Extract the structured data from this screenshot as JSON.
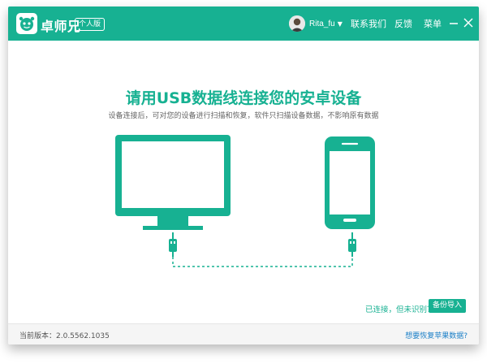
{
  "titlebar": {
    "app_name": "卓师兄",
    "edition": "个人版",
    "username": "Rita_fu",
    "nav_contact": "联系我们",
    "nav_feedback": "反馈",
    "nav_menu": "菜单"
  },
  "main": {
    "headline": "请用USB数据线连接您的安卓设备",
    "subline": "设备连接后，可对您的设备进行扫描和恢复，软件只扫描设备数据，不影响原有数据"
  },
  "actions": {
    "status_link": "已连接，但未识别？",
    "backup_button": "备份导入"
  },
  "footer": {
    "version": "当前版本：2.0.5562.1035",
    "ios_link": "想要恢复苹果数据?"
  },
  "colors": {
    "accent": "#17b192",
    "link": "#1a7fc7"
  }
}
